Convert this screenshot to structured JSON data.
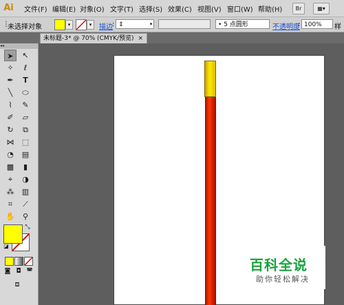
{
  "app": {
    "logo": "Ai"
  },
  "menu": {
    "items": [
      "文件(F)",
      "编辑(E)",
      "对象(O)",
      "文字(T)",
      "选择(S)",
      "效果(C)",
      "视图(V)",
      "窗口(W)",
      "帮助(H)"
    ],
    "bridge_label": "Br"
  },
  "control": {
    "selection_status": "未选择对象",
    "fill_color": "#ffff00",
    "stroke_label": "描边",
    "brush_label": "5 点圆形",
    "opacity_label": "不透明度",
    "opacity_value": "100%",
    "style_label": "样"
  },
  "document": {
    "tab_title": "未标题-3* @ 70% (CMYK/预览)",
    "close_symbol": "×"
  },
  "artwork": {
    "pencil_tip_color": "#ffe800",
    "pencil_body_color": "#ff3800"
  },
  "tools": {
    "panel_collapse": "◂◂",
    "fill_color": "#ffff00",
    "stroke_color": "#ffffff"
  },
  "watermark": {
    "title": "百科全说",
    "subtitle": "助你轻松解决",
    "color": "#1aa33d"
  }
}
